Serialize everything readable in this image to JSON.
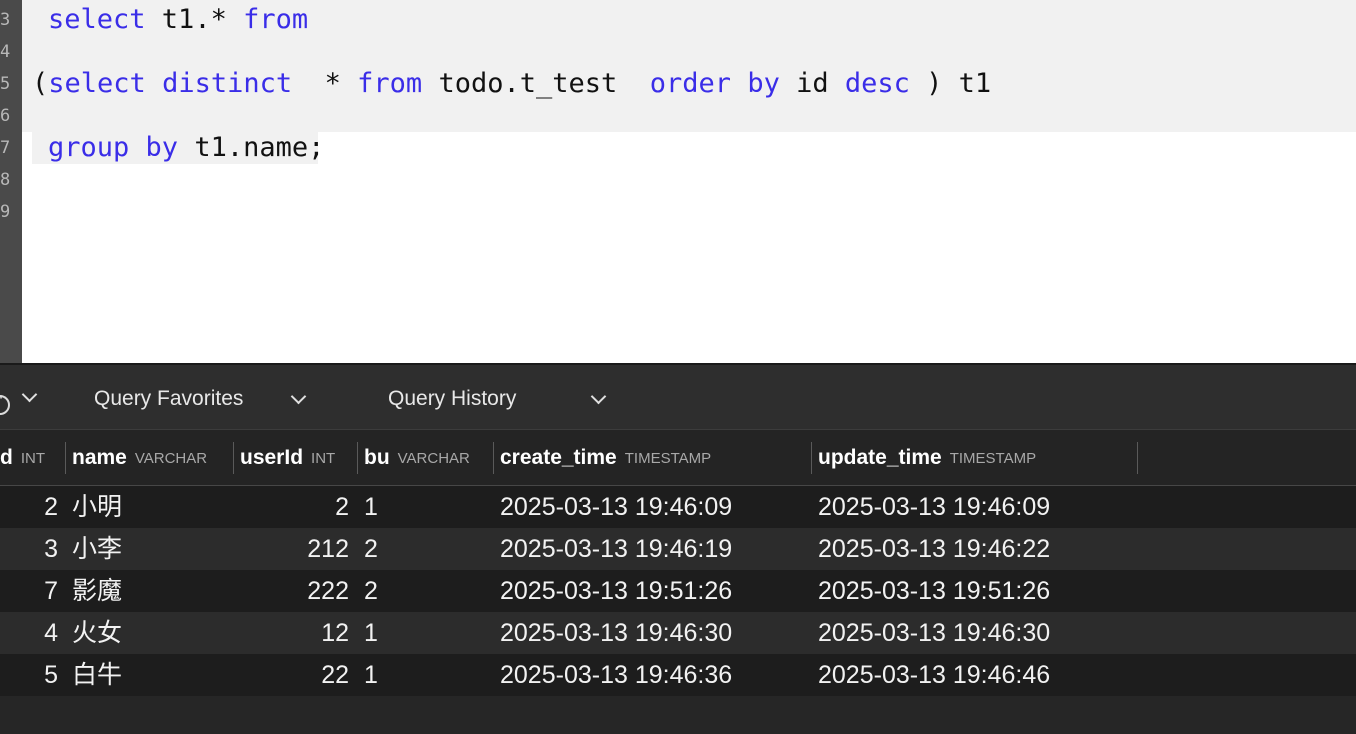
{
  "editor": {
    "line_numbers": [
      "3",
      "4",
      "5",
      "6",
      "7",
      "8",
      "9"
    ],
    "lines": [
      [
        {
          "t": "select",
          "k": true
        },
        {
          "t": " t1.* ",
          "k": false
        },
        {
          "t": "from",
          "k": true
        }
      ],
      [
        {
          "t": "(",
          "k": false
        },
        {
          "t": "select",
          "k": true
        },
        {
          "t": " ",
          "k": false
        },
        {
          "t": "distinct",
          "k": true
        },
        {
          "t": "  * ",
          "k": false
        },
        {
          "t": "from",
          "k": true
        },
        {
          "t": " todo.t_test  ",
          "k": false
        },
        {
          "t": "order",
          "k": true
        },
        {
          "t": " ",
          "k": false
        },
        {
          "t": "by",
          "k": true
        },
        {
          "t": " id ",
          "k": false
        },
        {
          "t": "desc",
          "k": true
        },
        {
          "t": " ) t1",
          "k": false
        }
      ],
      [
        {
          "t": "group",
          "k": true
        },
        {
          "t": " ",
          "k": false
        },
        {
          "t": "by",
          "k": true
        },
        {
          "t": " t1.name;",
          "k": false
        }
      ]
    ]
  },
  "toolbar": {
    "favorites_label": "Query Favorites",
    "history_label": "Query History"
  },
  "results": {
    "columns": [
      {
        "name": "d",
        "type": "INT"
      },
      {
        "name": "name",
        "type": "VARCHAR"
      },
      {
        "name": "userId",
        "type": "INT"
      },
      {
        "name": "bu",
        "type": "VARCHAR"
      },
      {
        "name": "create_time",
        "type": "TIMESTAMP"
      },
      {
        "name": "update_time",
        "type": "TIMESTAMP"
      }
    ],
    "rows": [
      [
        "2",
        "小明",
        "2",
        "1",
        "2025-03-13 19:46:09",
        "2025-03-13 19:46:09"
      ],
      [
        "3",
        "小李",
        "212",
        "2",
        "2025-03-13 19:46:19",
        "2025-03-13 19:46:22"
      ],
      [
        "7",
        "影魔",
        "222",
        "2",
        "2025-03-13 19:51:26",
        "2025-03-13 19:51:26"
      ],
      [
        "4",
        "火女",
        "12",
        "1",
        "2025-03-13 19:46:30",
        "2025-03-13 19:46:30"
      ],
      [
        "5",
        "白牛",
        "22",
        "1",
        "2025-03-13 19:46:36",
        "2025-03-13 19:46:46"
      ]
    ]
  },
  "colors": {
    "keyword": "#3a2de8",
    "editor_highlight": "#f1f1f1",
    "grid_background": "#1e1e1e"
  },
  "icons": [
    "more-options-icon",
    "chevron-down-icon"
  ]
}
